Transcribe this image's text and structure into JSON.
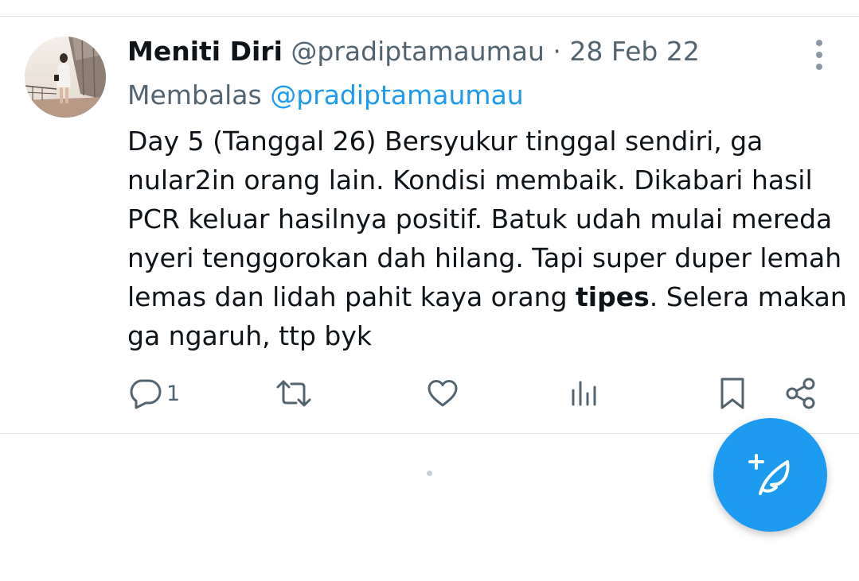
{
  "tweet": {
    "display_name": "Meniti Diri",
    "handle": "@pradiptamaumau",
    "separator": "·",
    "date": "28 Feb 22",
    "reply_prefix": "Membalas",
    "reply_to": "@pradiptamaumau",
    "text_lines": [
      "Day 5 (Tanggal 26) Bersyukur tinggal sendiri, ga",
      "nular2in orang lain. Kondisi membaik. Dikabari hasil",
      "PCR keluar hasilnya positif. Batuk udah mulai mereda",
      "nyeri tenggorokan dah hilang. Tapi super duper lemah"
    ],
    "line5_before": "lemas dan lidah pahit kaya orang ",
    "line5_bold": "tipes",
    "line5_after": ". Selera makan",
    "line6": "ga ngaruh, ttp byk",
    "reply_count": "1"
  },
  "icons": {
    "avatar": "avatar-photo",
    "more": "more-vertical-icon",
    "reply": "reply-bubble-icon",
    "retweet": "retweet-icon",
    "like": "heart-icon",
    "views": "analytics-bars-icon",
    "bookmark": "bookmark-icon",
    "share": "share-icon",
    "compose": "compose-feather-icon"
  },
  "colors": {
    "accent": "#1d9bf0",
    "secondary_text": "#536471",
    "primary_text": "#0f1419",
    "icon": "#536471",
    "divider": "#e6e9ec"
  }
}
